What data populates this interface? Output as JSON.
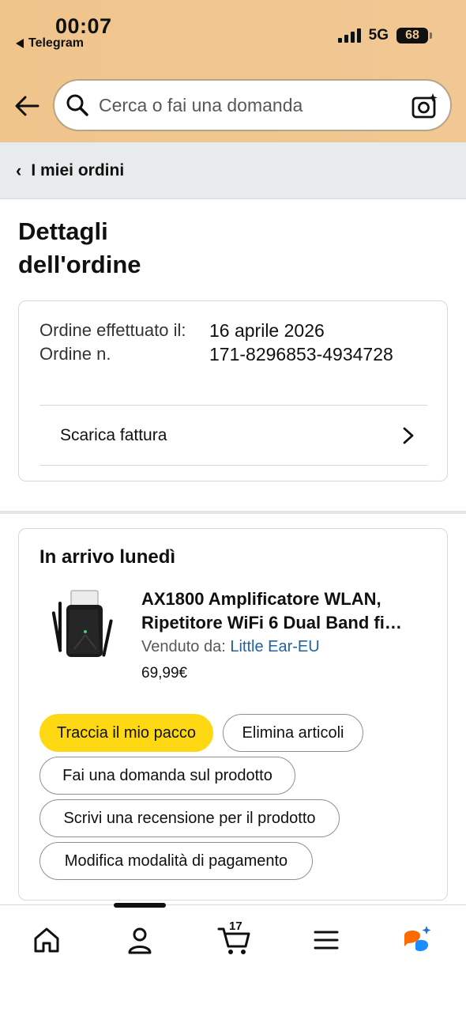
{
  "status_bar": {
    "time": "00:07",
    "back_app": "Telegram",
    "network": "5G",
    "battery": "68"
  },
  "search": {
    "placeholder": "Cerca o fai una domanda"
  },
  "breadcrumb": {
    "label": "I miei ordini"
  },
  "page": {
    "title": "Dettagli dell'ordine"
  },
  "order_info": {
    "label_date": "Ordine effettuato il:",
    "label_number": "Ordine n.",
    "date": "16 aprile 2026",
    "number": "171-8296853-4934728",
    "invoice_label": "Scarica fattura"
  },
  "delivery": {
    "title": "In arrivo lunedì",
    "product_name": "AX1800 Amplificatore WLAN, Ripetitore WiFi 6 Dual Band fi…",
    "seller_prefix": "Venduto da:",
    "seller_name": "Little Ear-EU",
    "price": "69,99€",
    "buttons": {
      "track": "Traccia il mio pacco",
      "delete": "Elimina articoli",
      "ask": "Fai una domanda sul prodotto",
      "review": "Scrivi una recensione per il prodotto",
      "payment": "Modifica modalità di pagamento"
    }
  },
  "bottom_nav": {
    "cart_count": "17",
    "icons": [
      "home-icon",
      "account-icon",
      "cart-icon",
      "menu-icon",
      "rufus-ai-icon"
    ]
  },
  "colors": {
    "header": "#f0c690",
    "primary_button": "#ffd814",
    "link": "#2162a1",
    "ai_orange": "#ff6a00",
    "ai_blue": "#1a8cff"
  }
}
